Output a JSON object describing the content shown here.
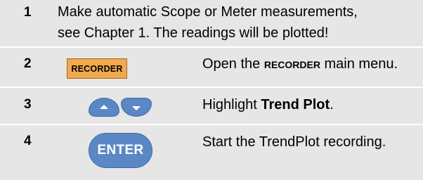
{
  "steps": [
    {
      "number": "1",
      "line1": "Make automatic Scope or Meter measurements,",
      "line2": "see Chapter 1. The readings will be plotted!"
    },
    {
      "number": "2",
      "key_label": "RECORDER",
      "key_color": "#f0a94e",
      "text_before": "Open the ",
      "text_bold": "RECORDER",
      "text_after": " main menu."
    },
    {
      "number": "3",
      "keys": [
        "up-arrow-icon",
        "down-arrow-icon"
      ],
      "key_color": "#5b88c5",
      "text_before": "Highlight ",
      "text_bold": "Trend Plot",
      "text_after": "."
    },
    {
      "number": "4",
      "key_label": "ENTER",
      "key_color": "#5b88c5",
      "text": "Start the TrendPlot recording."
    }
  ],
  "row_background": "#e6e6e6"
}
